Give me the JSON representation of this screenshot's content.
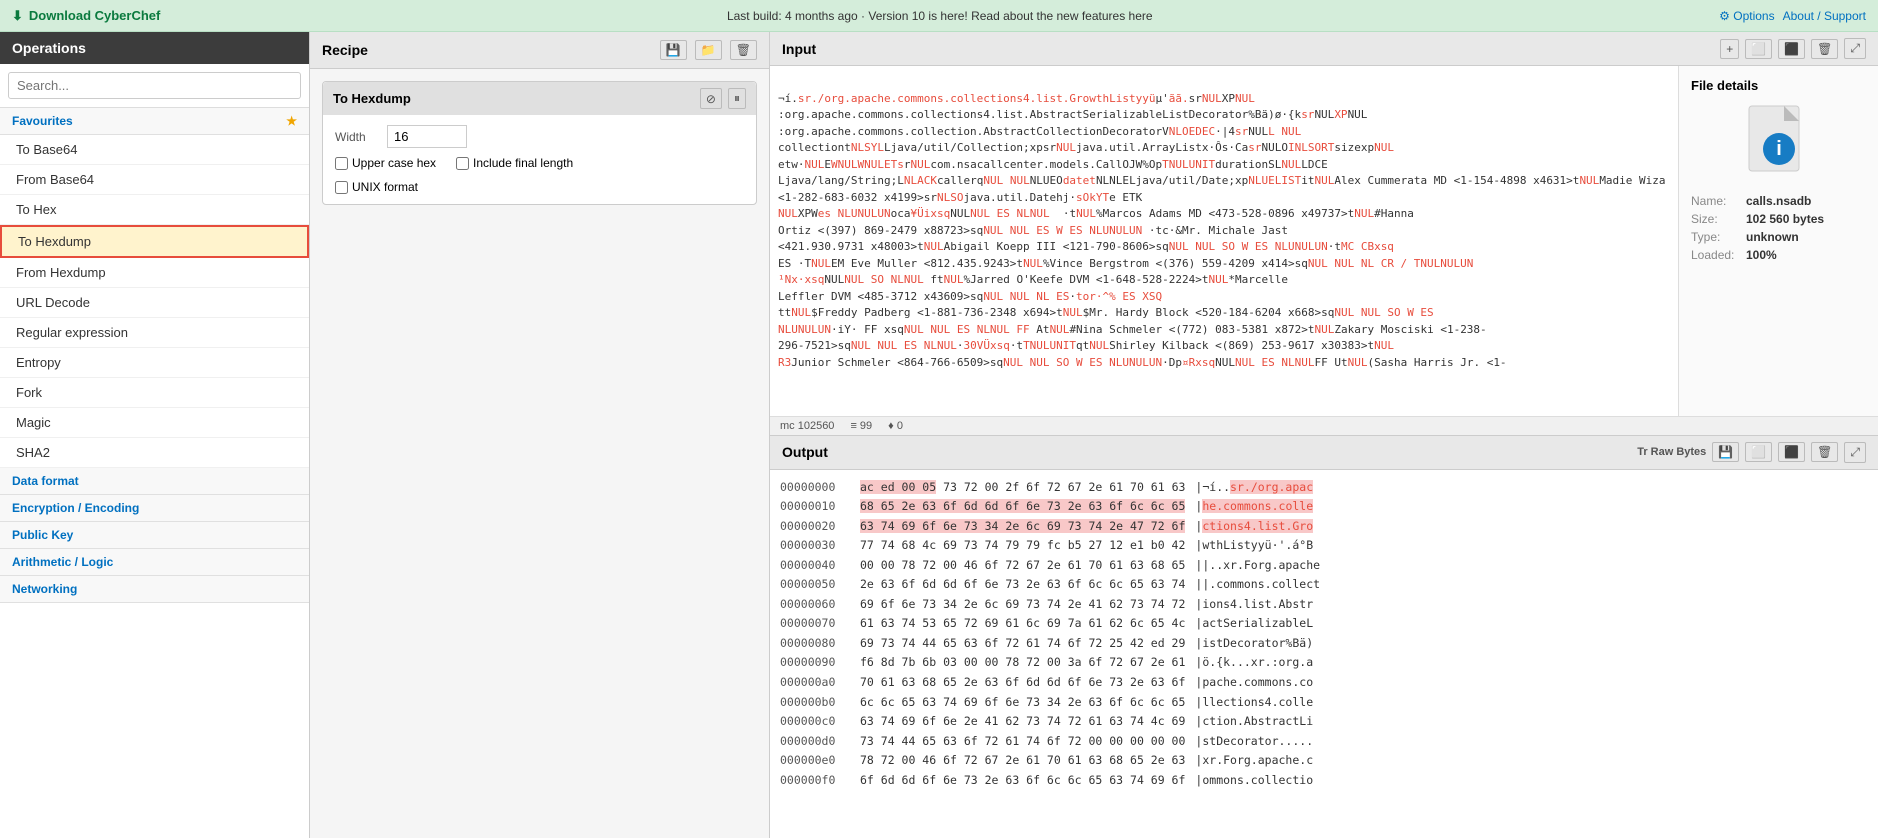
{
  "topbar": {
    "download": "Download CyberChef",
    "build_info": "Last build: 4 months ago · Version 10 is here! Read about the new features here",
    "options": "Options",
    "about": "About / Support"
  },
  "sidebar": {
    "title": "Operations",
    "search_placeholder": "Search...",
    "sections": [
      {
        "name": "Favourites",
        "items": [
          "To Base64",
          "From Base64",
          "To Hex",
          "To Hexdump",
          "From Hexdump",
          "URL Decode",
          "Regular expression",
          "Entropy",
          "Fork",
          "Magic",
          "SHA2"
        ]
      },
      {
        "name": "Data format",
        "items": []
      },
      {
        "name": "Encryption / Encoding",
        "items": []
      },
      {
        "name": "Public Key",
        "items": []
      },
      {
        "name": "Arithmetic / Logic",
        "items": []
      },
      {
        "name": "Networking",
        "items": []
      }
    ]
  },
  "recipe": {
    "title": "Recipe",
    "card_title": "To Hexdump",
    "width_label": "Width",
    "width_value": "16",
    "upper_case_label": "Upper case hex",
    "final_length_label": "Include final length",
    "unix_format_label": "UNIX format"
  },
  "input": {
    "title": "Input",
    "status_bytes": "mc 102560",
    "status_lines": "≡ 99",
    "status_pos": "♦ 0",
    "file_details": {
      "title": "File details",
      "name_label": "Name:",
      "name_value": "calls.nsadb",
      "size_label": "Size:",
      "size_value": "102 560 bytes",
      "type_label": "Type:",
      "type_value": "unknown",
      "loaded_label": "Loaded:",
      "loaded_value": "100%"
    }
  },
  "output": {
    "title": "Output",
    "rows": [
      {
        "offset": "00000000",
        "bytes": "ac ed 00 05 73 72 00 2f 6f 72 67 2e 61 70 61 63",
        "ascii": "¬í..sr./org.apac"
      },
      {
        "offset": "00000010",
        "bytes": "68 65 2e 63 6f 6d 6d 6f 6e 73 2e 63 6f 6c 6c 65",
        "ascii": "he.commons.colle"
      },
      {
        "offset": "00000020",
        "bytes": "63 74 69 6f 6e 73 34 2e 6c 69 73 74 2e 47 72 6f",
        "ascii": "ctions4.list.Gro"
      },
      {
        "offset": "00000030",
        "bytes": "77 74 68 4c 69 73 74 79 79 fc b5 27 12 e1 b0 42",
        "ascii": "wthListyyü·'.á°B"
      },
      {
        "offset": "00000040",
        "bytes": "00 00 78 72 00 46 6f 72 67 2e 61 70 61 63 68 65",
        "ascii": "|..xr.Forg.apache"
      },
      {
        "offset": "00000050",
        "bytes": "2e 63 6f 6d 6d 6f 6e 73 2e 63 6f 6c 6c 65 63 74",
        "ascii": "|.commons.collect"
      },
      {
        "offset": "00000060",
        "bytes": "69 6f 6e 73 34 2e 6c 69 73 74 2e 41 62 73 74 72",
        "ascii": "ions4.list.Abstr"
      },
      {
        "offset": "00000070",
        "bytes": "61 63 74 53 65 72 69 61 6c 69 7a 61 62 6c 65 4c",
        "ascii": "actSerializableL"
      },
      {
        "offset": "00000080",
        "bytes": "69 73 74 44 65 63 6f 72 61 74 6f 72 25 42 ed 29",
        "ascii": "istDecorator%Bä)"
      },
      {
        "offset": "00000090",
        "bytes": "f6 8d 7b 6b 03 00 00 78 72 00 3a 6f 72 67 2e 61",
        "ascii": "ö.{k...xr.:org.a"
      },
      {
        "offset": "000000a0",
        "bytes": "70 61 63 68 65 2e 63 6f 6d 6d 6f 6e 73 2e 63 6f",
        "ascii": "pache.commons.co"
      },
      {
        "offset": "000000b0",
        "bytes": "6c 6c 65 63 74 69 6f 6e 73 34 2e 63 6f 6c 6c 65",
        "ascii": "llections4.colle"
      },
      {
        "offset": "000000c0",
        "bytes": "63 74 69 6f 6e 2e 41 62 73 74 72 61 63 74 4c 69",
        "ascii": "ction.AbstractLi"
      },
      {
        "offset": "000000d0",
        "bytes": "73 74 44 65 63 6f 72 61 74 6f 72 00 00 00 00 00",
        "ascii": "stDecorator....."
      },
      {
        "offset": "000000e0",
        "bytes": "78 72 00 46 6f 72 67 2e 61 70 61 63 68 65 2e 63",
        "ascii": "xr.Forg.apache.c"
      },
      {
        "offset": "000000f0",
        "bytes": "6f 6d 6d 6f 6e 73 2e 63 6f 6c 6c 65 63 74 69 6f",
        "ascii": "ommons.collectio"
      }
    ]
  }
}
